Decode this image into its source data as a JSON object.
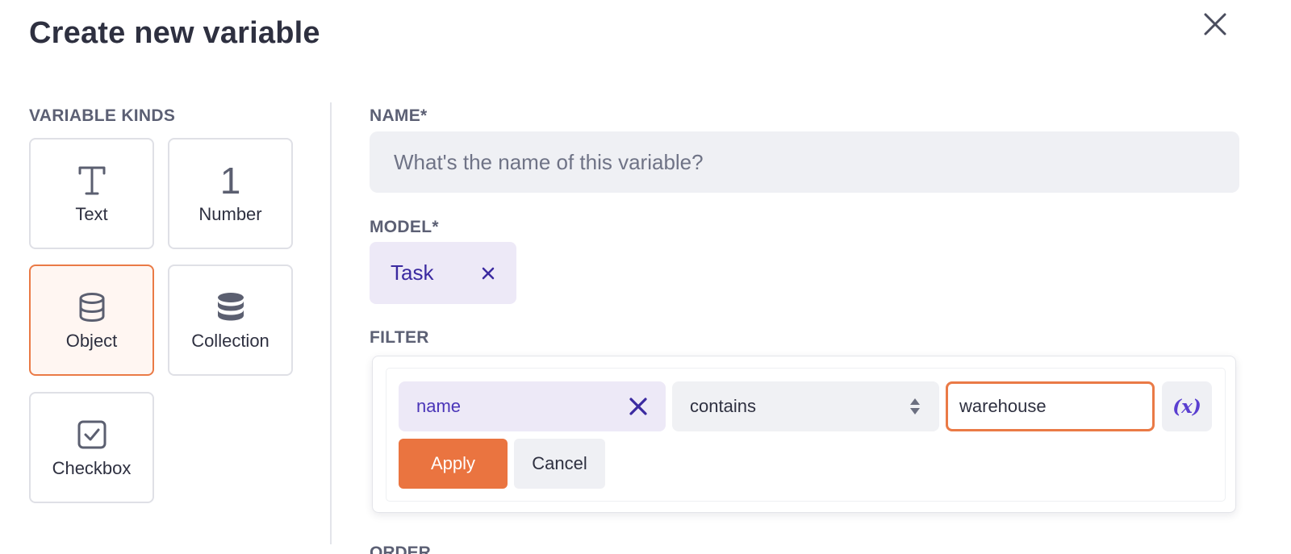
{
  "dialog": {
    "title": "Create new variable",
    "close_icon": "close-icon"
  },
  "kinds": {
    "heading": "VARIABLE KINDS",
    "items": [
      {
        "label": "Text",
        "icon": "text-icon"
      },
      {
        "label": "Number",
        "icon": "number-icon",
        "glyph": "1"
      },
      {
        "label": "Object",
        "icon": "database-outline-icon",
        "selected": true
      },
      {
        "label": "Collection",
        "icon": "database-stack-icon"
      },
      {
        "label": "Checkbox",
        "icon": "checkbox-icon"
      }
    ]
  },
  "name_field": {
    "label": "NAME*",
    "placeholder": "What's the name of this variable?",
    "value": ""
  },
  "model_field": {
    "label": "MODEL*",
    "selected": "Task"
  },
  "filter": {
    "label": "FILTER",
    "field": "name",
    "operator": "contains",
    "value": "warehouse",
    "variable_button": "(x)",
    "apply_label": "Apply",
    "cancel_label": "Cancel"
  },
  "next_section_label_partial": "ORDER",
  "colors": {
    "accent_orange": "#ea7440",
    "chip_purple_bg": "#ede9f7",
    "chip_purple_text": "#3b2aa0",
    "input_bg": "#eff0f4"
  }
}
